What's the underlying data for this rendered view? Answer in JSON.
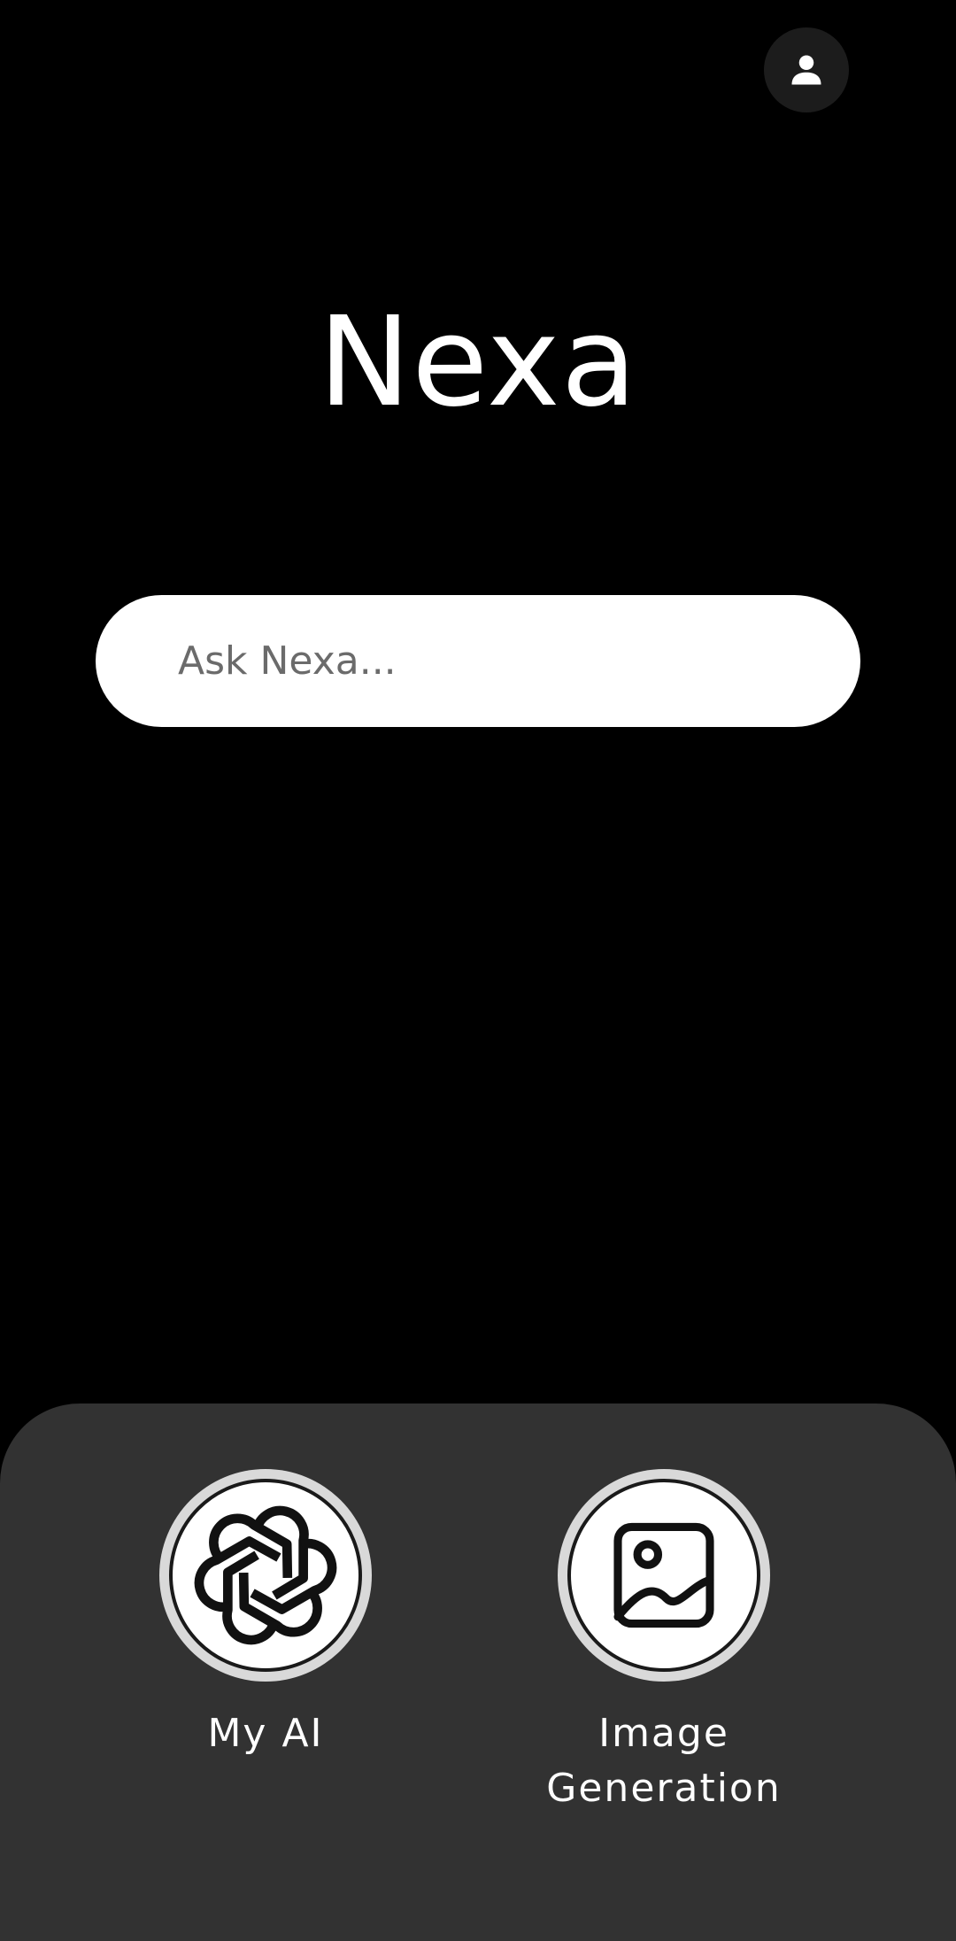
{
  "header": {
    "profile_icon": "person-icon"
  },
  "app": {
    "title": "Nexa"
  },
  "search": {
    "placeholder": "Ask Nexa...",
    "value": ""
  },
  "features": {
    "my_ai": {
      "label": "My AI",
      "icon": "openai-logo-icon"
    },
    "image_generation": {
      "label": "Image\nGeneration",
      "icon": "image-icon"
    }
  },
  "colors": {
    "background": "#000000",
    "sheet": "#323232",
    "search_bg": "#ffffff",
    "profile_bg": "#1c1c1c"
  }
}
